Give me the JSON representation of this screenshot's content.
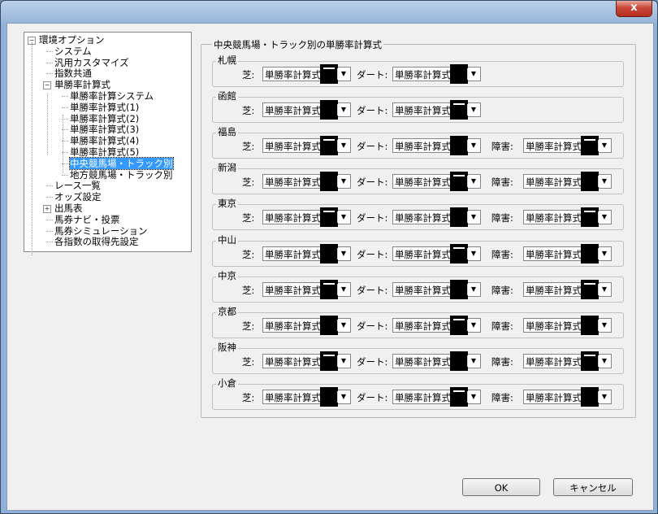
{
  "window": {
    "close_label": "x"
  },
  "tree": {
    "items": [
      {
        "label": "環境オプション",
        "level": 0,
        "expander": "−"
      },
      {
        "label": "システム",
        "level": 1
      },
      {
        "label": "汎用カスタマイズ",
        "level": 1
      },
      {
        "label": "指数共通",
        "level": 1
      },
      {
        "label": "単勝率計算式",
        "level": 1,
        "expander": "−"
      },
      {
        "label": "単勝率計算システム",
        "level": 2
      },
      {
        "label": "単勝率計算式(1)",
        "level": 2
      },
      {
        "label": "単勝率計算式(2)",
        "level": 2
      },
      {
        "label": "単勝率計算式(3)",
        "level": 2
      },
      {
        "label": "単勝率計算式(4)",
        "level": 2
      },
      {
        "label": "単勝率計算式(5)",
        "level": 2
      },
      {
        "label": "中央競馬場・トラック別",
        "level": 2,
        "selected": true
      },
      {
        "label": "地方競馬場・トラック別",
        "level": 2
      },
      {
        "label": "レース一覧",
        "level": 1
      },
      {
        "label": "オッズ設定",
        "level": 1
      },
      {
        "label": "出馬表",
        "level": 1,
        "expander": "+"
      },
      {
        "label": "馬券ナビ・投票",
        "level": 1
      },
      {
        "label": "馬券シミュレーション",
        "level": 1
      },
      {
        "label": "各指数の取得先設定",
        "level": 1
      }
    ]
  },
  "group_title": "中央競馬場・トラック別の単勝率計算式",
  "labels": {
    "turf": "芝:",
    "dirt": "ダート:",
    "hurdle": "障害:"
  },
  "combo_value": "単勝率計算式",
  "tracks": [
    {
      "name": "札幌",
      "hurdle": false
    },
    {
      "name": "函館",
      "hurdle": false
    },
    {
      "name": "福島",
      "hurdle": true
    },
    {
      "name": "新潟",
      "hurdle": true
    },
    {
      "name": "東京",
      "hurdle": true
    },
    {
      "name": "中山",
      "hurdle": true
    },
    {
      "name": "中京",
      "hurdle": true
    },
    {
      "name": "京都",
      "hurdle": true
    },
    {
      "name": "阪神",
      "hurdle": true
    },
    {
      "name": "小倉",
      "hurdle": true
    }
  ],
  "buttons": {
    "ok": "OK",
    "cancel": "キャンセル"
  }
}
